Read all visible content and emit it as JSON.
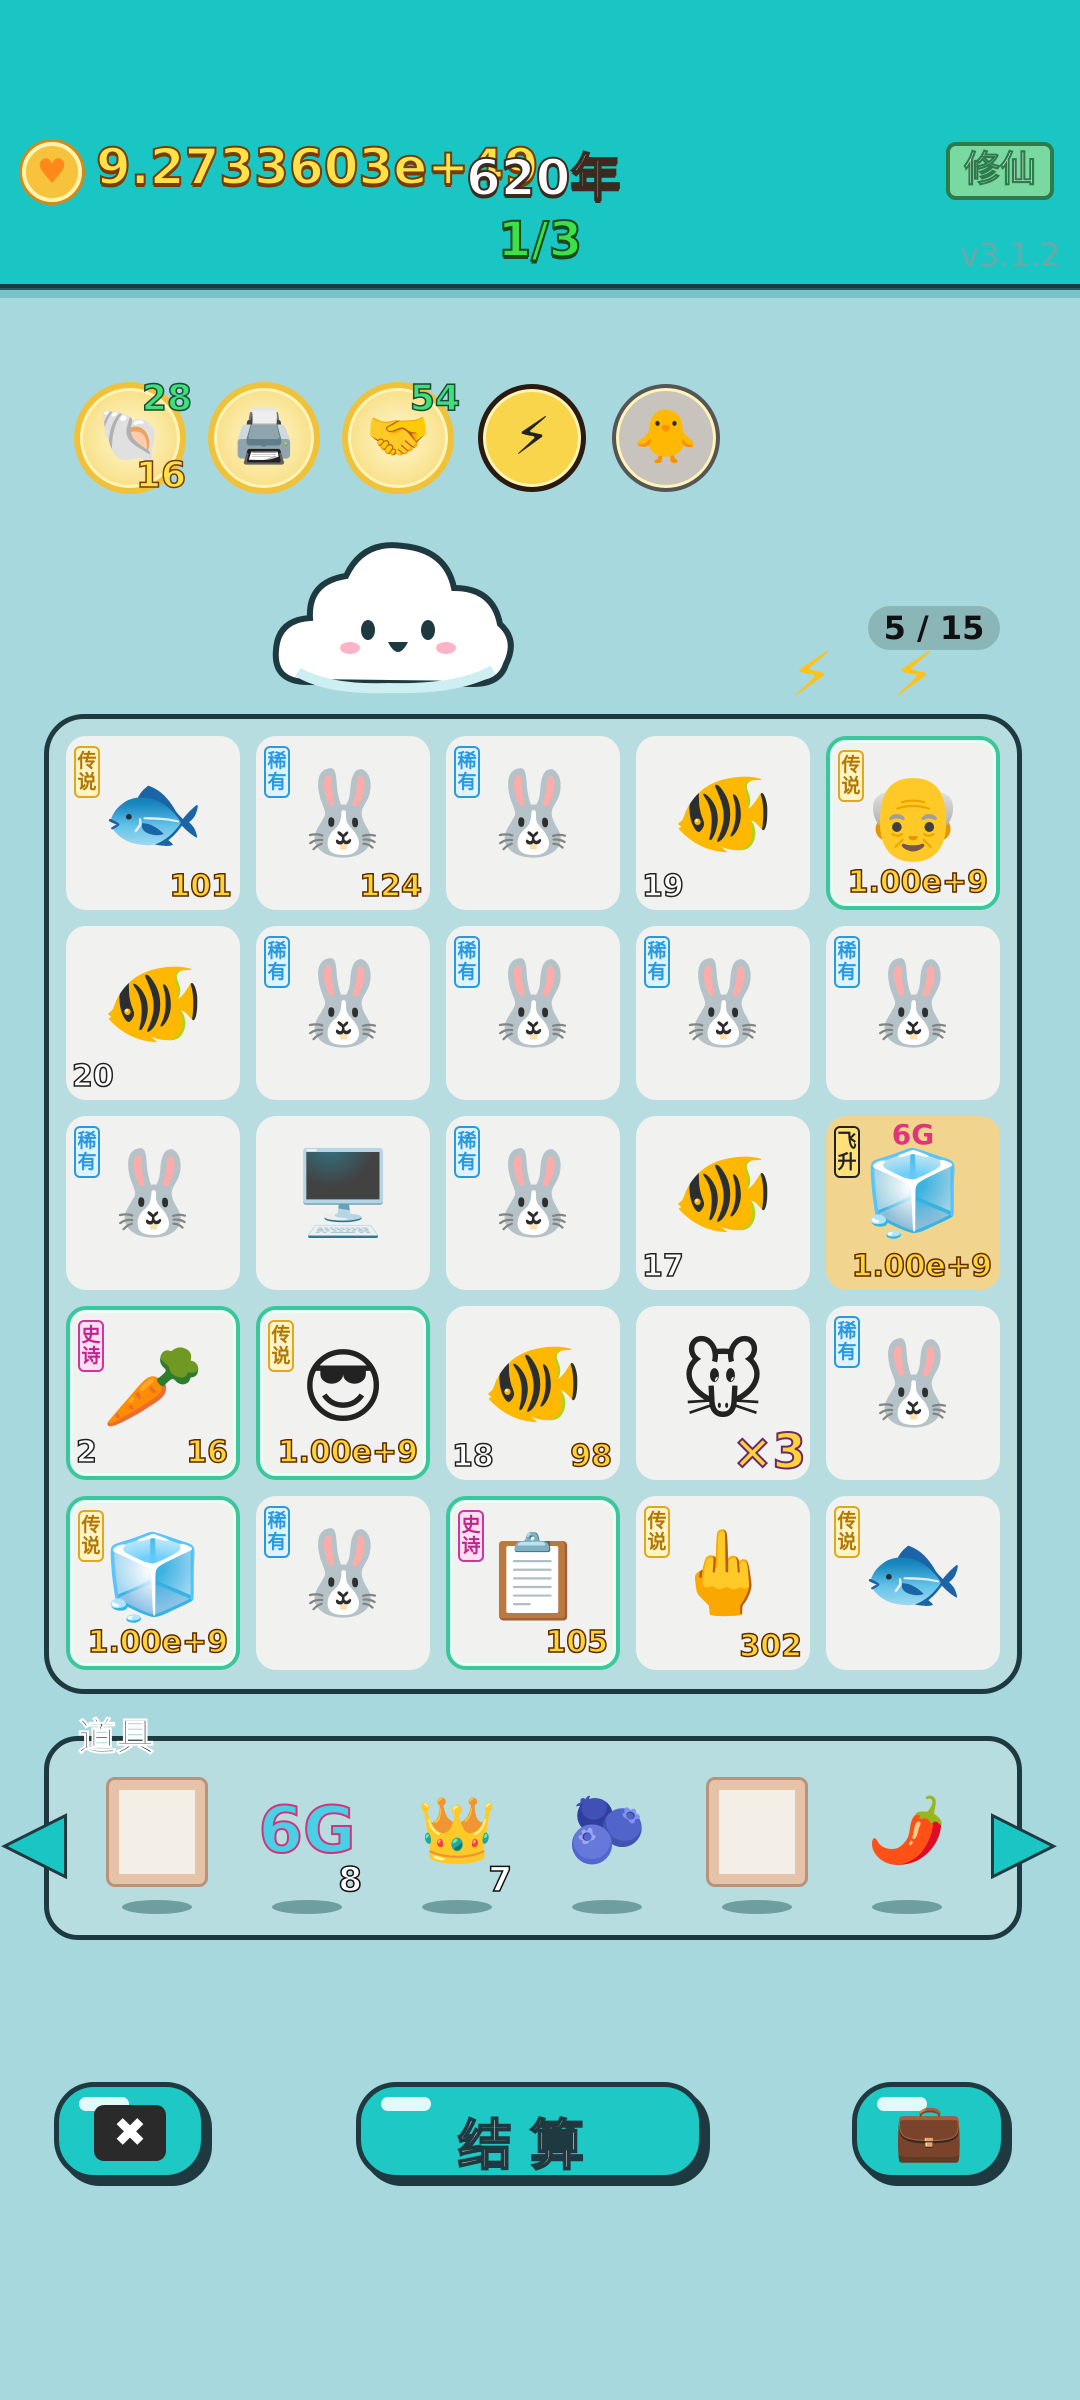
{
  "header": {
    "coin_icon": "heart-coin-icon",
    "coin_amount": "9.2733603e+49",
    "year": "620年",
    "stage": "1/3",
    "cultivate_label": "修仙",
    "version": "v3.1.2"
  },
  "badges": [
    {
      "name": "shell",
      "icon": "🐚",
      "count_top": "28",
      "count_bottom": "16"
    },
    {
      "name": "printer",
      "icon": "🖨️"
    },
    {
      "name": "handshake",
      "icon": "🤝",
      "count_top": "54"
    },
    {
      "name": "lightning",
      "icon": "⚡"
    },
    {
      "name": "chick-egg",
      "icon": "🐥"
    }
  ],
  "level_count": "5 / 15",
  "board": {
    "rows": [
      [
        {
          "icon": "🐟",
          "tag": "传说",
          "tier": "leg",
          "num_right": "101"
        },
        {
          "icon": "🐰",
          "tag": "稀有",
          "tier": "rare",
          "num_right": "124"
        },
        {
          "icon": "🐰",
          "tag": "稀有",
          "tier": "rare"
        },
        {
          "icon": "🐠",
          "num_left": "19"
        },
        {
          "icon": "👴",
          "tag": "传说",
          "tier": "leg",
          "num_right": "1.00e+9",
          "highlight": true
        }
      ],
      [
        {
          "icon": "🐠",
          "num_left": "20"
        },
        {
          "icon": "🐰",
          "tag": "稀有",
          "tier": "rare"
        },
        {
          "icon": "🐰",
          "tag": "稀有",
          "tier": "rare"
        },
        {
          "icon": "🐰",
          "tag": "稀有",
          "tier": "rare"
        },
        {
          "icon": "🐰",
          "tag": "稀有",
          "tier": "rare"
        }
      ],
      [
        {
          "icon": "🐰",
          "tag": "稀有",
          "tier": "rare"
        },
        {
          "icon": "🖥️"
        },
        {
          "icon": "🐰",
          "tag": "稀有",
          "tier": "rare"
        },
        {
          "icon": "🐠",
          "num_left": "17"
        },
        {
          "icon": "🧊",
          "tag": "飞升",
          "tier": "fly",
          "sub": "6G",
          "num_right": "1.00e+9",
          "gold": true
        }
      ],
      [
        {
          "icon": "🥕",
          "tag": "史诗",
          "tier": "epic",
          "num_left": "2",
          "num_right": "16",
          "highlight": true
        },
        {
          "icon": "😎",
          "tag": "传说",
          "tier": "leg",
          "num_right": "1.00e+9",
          "highlight": true
        },
        {
          "icon": "🐠",
          "num_left": "18",
          "num_right": "98"
        },
        {
          "icon": "🐭",
          "multiplier": "×3"
        },
        {
          "icon": "🐰",
          "tag": "稀有",
          "tier": "rare"
        }
      ],
      [
        {
          "icon": "🧊",
          "tag": "传说",
          "tier": "leg",
          "num_right": "1.00e+9",
          "highlight": true
        },
        {
          "icon": "🐰",
          "tag": "稀有",
          "tier": "rare"
        },
        {
          "icon": "📋",
          "tag": "史诗",
          "tier": "epic",
          "num_right": "105",
          "highlight": true
        },
        {
          "icon": "🖕",
          "tag": "传说",
          "tier": "leg",
          "num_right": "302"
        },
        {
          "icon": "🐟",
          "tag": "传说",
          "tier": "leg"
        }
      ]
    ]
  },
  "props": {
    "label": "道具",
    "items": [
      {
        "name": "frame",
        "type": "frame"
      },
      {
        "name": "6g",
        "type": "6g",
        "text": "6G",
        "count": "8"
      },
      {
        "name": "crown",
        "type": "emoji",
        "icon": "👑",
        "count": "7"
      },
      {
        "name": "blueberry",
        "type": "emoji",
        "icon": "🫐"
      },
      {
        "name": "frame-2",
        "type": "frame"
      },
      {
        "name": "chili",
        "type": "emoji",
        "icon": "🌶️"
      }
    ]
  },
  "bottom": {
    "settle_label": "结算"
  }
}
